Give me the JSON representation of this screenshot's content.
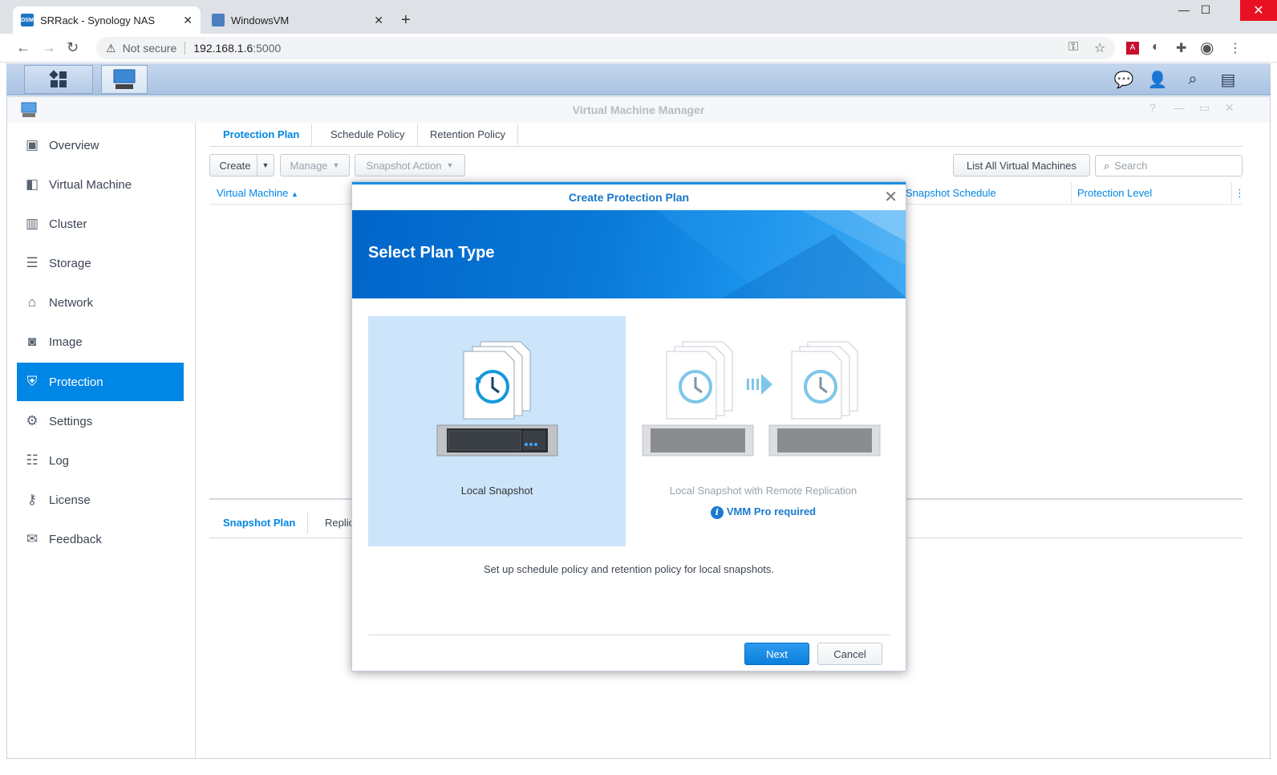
{
  "browser": {
    "tabs": [
      {
        "title": "SRRack - Synology NAS",
        "favicon": "DSM",
        "active": true
      },
      {
        "title": "WindowsVM",
        "active": false
      }
    ],
    "address": {
      "warning": "Not secure",
      "host": "192.168.1.6",
      "port": ":5000"
    }
  },
  "app": {
    "title": "Virtual Machine Manager",
    "sidebar": [
      {
        "label": "Overview",
        "icon": "overview-icon"
      },
      {
        "label": "Virtual Machine",
        "icon": "virtual-machine-icon"
      },
      {
        "label": "Cluster",
        "icon": "cluster-icon"
      },
      {
        "label": "Storage",
        "icon": "storage-icon"
      },
      {
        "label": "Network",
        "icon": "network-icon"
      },
      {
        "label": "Image",
        "icon": "image-icon"
      },
      {
        "label": "Protection",
        "icon": "protection-icon",
        "active": true
      },
      {
        "label": "Settings",
        "icon": "gear-icon"
      },
      {
        "label": "Log",
        "icon": "log-icon"
      },
      {
        "label": "License",
        "icon": "key-icon"
      },
      {
        "label": "Feedback",
        "icon": "mail-icon"
      }
    ],
    "tabs": [
      "Protection Plan",
      "Schedule Policy",
      "Retention Policy"
    ],
    "toolbar": {
      "create": "Create",
      "manage": "Manage",
      "snapshot_action": "Snapshot Action",
      "list_all": "List All Virtual Machines",
      "search_placeholder": "Search"
    },
    "columns": {
      "vm": "Virtual Machine",
      "schedule": "Snapshot Schedule",
      "level": "Protection Level"
    },
    "bottom_tabs": [
      "Snapshot Plan",
      "Replic"
    ]
  },
  "modal": {
    "title": "Create Protection Plan",
    "heading": "Select Plan Type",
    "options": [
      {
        "label": "Local Snapshot",
        "selected": true
      },
      {
        "label": "Local Snapshot with Remote Replication",
        "selected": false
      }
    ],
    "pro_note": "VMM Pro required",
    "description": "Set up schedule policy and retention policy for local snapshots.",
    "next": "Next",
    "cancel": "Cancel"
  },
  "colors": {
    "accent": "#0086e5",
    "sidebar_active": "#0086e5",
    "banner": "#0a79d8"
  }
}
